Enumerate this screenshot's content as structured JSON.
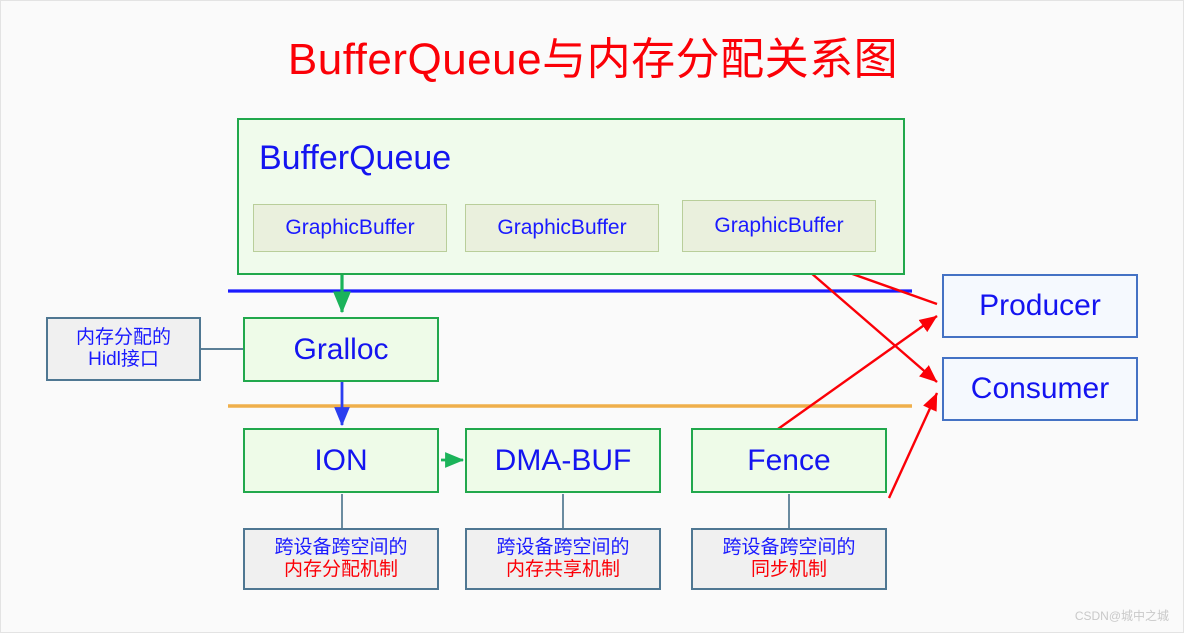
{
  "title": "BufferQueue与内存分配关系图",
  "colors": {
    "title_red": "#fb0007",
    "node_blue_text": "#1414f0",
    "green_border": "#21a84c",
    "green_fill": "#eefbe8",
    "group_fill": "#f0fbec",
    "graphicbuffer_fill": "#eaf0dd",
    "graphicbuffer_border": "#b9ce9a",
    "note_fill": "#f0f0f0",
    "note_border": "#4f7792",
    "producer_border": "#4472c4",
    "producer_fill": "#f5f9fe",
    "arrow_red": "#fb0007",
    "divider_blue": "#1a1aff",
    "divider_orange": "#efaf4b",
    "canvas_bg": "#fafafa"
  },
  "bufferqueue": {
    "label": "BufferQueue",
    "buffers": [
      {
        "label": "GraphicBuffer"
      },
      {
        "label": "GraphicBuffer"
      },
      {
        "label": "GraphicBuffer"
      }
    ]
  },
  "nodes": {
    "gralloc": "Gralloc",
    "ion": "ION",
    "dmabuf": "DMA-BUF",
    "fence": "Fence",
    "producer": "Producer",
    "consumer": "Consumer"
  },
  "notes": {
    "hidl": {
      "line1": "内存分配的",
      "line2": "Hidl接口"
    },
    "ion": {
      "line1": "跨设备跨空间的",
      "line2": "内存分配机制"
    },
    "dmabuf": {
      "line1": "跨设备跨空间的",
      "line2": "内存共享机制"
    },
    "fence": {
      "line1": "跨设备跨空间的",
      "line2": "同步机制"
    }
  },
  "watermark": "CSDN@城中之城"
}
